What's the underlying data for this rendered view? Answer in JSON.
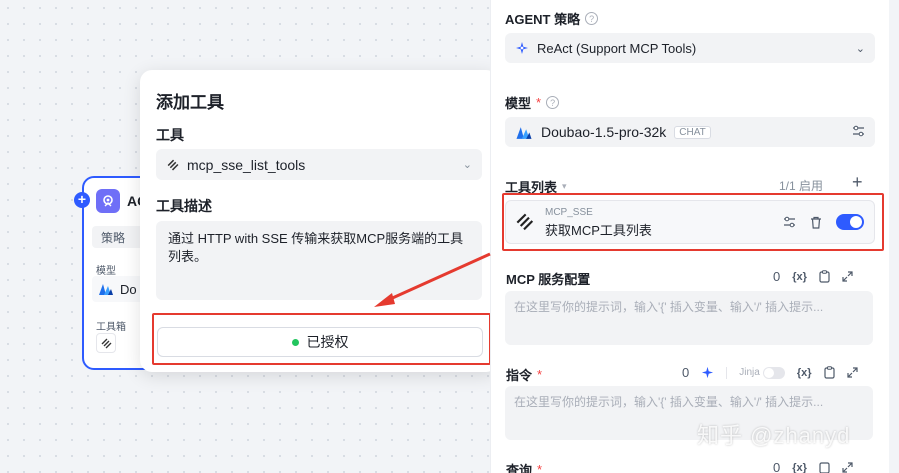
{
  "node": {
    "title": "AG",
    "strategy": "策略",
    "model_label": "模型",
    "model_value": "Do",
    "tools_label": "工具箱"
  },
  "popup": {
    "title": "添加工具",
    "tool_label": "工具",
    "tool_value": "mcp_sse_list_tools",
    "desc_label": "工具描述",
    "desc_text": "通过 HTTP with SSE 传输来获取MCP服务端的工具列表。",
    "auth_label": "已授权"
  },
  "panel": {
    "strategy_label": "AGENT 策略",
    "strategy_value": "ReAct (Support MCP Tools)",
    "model_label": "模型",
    "model_value": "Doubao-1.5-pro-32k",
    "model_tag": "CHAT",
    "tools_label": "工具列表",
    "tools_count": "1/1 启用",
    "tool_name": "MCP_SSE",
    "tool_desc": "获取MCP工具列表",
    "mcp_config_label": "MCP 服务配置",
    "mcp_config_count": "0",
    "placeholder": "在这里写你的提示词，输入'{' 插入变量、输入'/' 插入提示...",
    "instruction_label": "指令",
    "instruction_count": "0",
    "jinja_label": "Jinja",
    "query_label": "查询",
    "query_count": "0",
    "var_label": "{x}"
  },
  "watermark": "知乎 @zhanyd",
  "colors": {
    "accent": "#2e5bff",
    "highlight": "#e53a2f",
    "success": "#22c55e"
  }
}
